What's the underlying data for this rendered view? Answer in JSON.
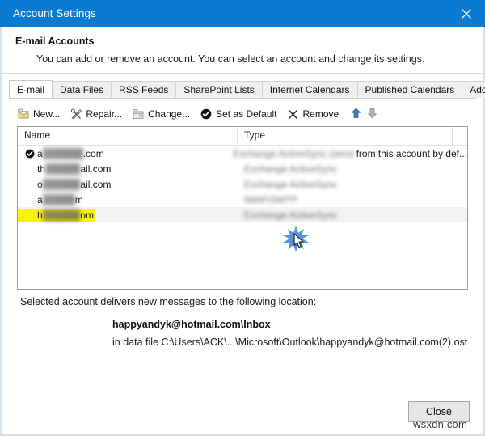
{
  "window": {
    "title": "Account Settings",
    "close_icon": "close-icon"
  },
  "header": {
    "title": "E-mail Accounts",
    "description": "You can add or remove an account. You can select an account and change its settings."
  },
  "tabs": [
    {
      "label": "E-mail",
      "active": true
    },
    {
      "label": "Data Files",
      "active": false
    },
    {
      "label": "RSS Feeds",
      "active": false
    },
    {
      "label": "SharePoint Lists",
      "active": false
    },
    {
      "label": "Internet Calendars",
      "active": false
    },
    {
      "label": "Published Calendars",
      "active": false
    },
    {
      "label": "Address Books",
      "active": false
    }
  ],
  "toolbar": {
    "new_label": "New...",
    "repair_label": "Repair...",
    "change_label": "Change...",
    "set_as_default_label": "Set as Default",
    "remove_label": "Remove",
    "move_up_icon": "arrow-up-icon",
    "move_down_icon": "arrow-down-icon"
  },
  "accounts_list": {
    "columns": [
      "Name",
      "Type"
    ],
    "rows": [
      {
        "is_default": true,
        "name_visible_start": "a",
        "name_redacted": "               ",
        "name_visible_end": ".com",
        "type_redacted": "Exchange ActiveSync (send",
        "type_visible_end": "from this account by def...",
        "highlighted": false
      },
      {
        "is_default": false,
        "name_visible_start": "th",
        "name_redacted": "             ",
        "name_visible_end": "ail.com",
        "type_redacted": "Exchange ActiveSync",
        "type_visible_end": "",
        "highlighted": false
      },
      {
        "is_default": false,
        "name_visible_start": "o",
        "name_redacted": "              ",
        "name_visible_end": "ail.com",
        "type_redacted": "Exchange ActiveSync",
        "type_visible_end": "",
        "highlighted": false
      },
      {
        "is_default": false,
        "name_visible_start": "a",
        "name_redacted": "            ",
        "name_visible_end": "m",
        "type_redacted": "IMAP/SMTP",
        "type_visible_end": "",
        "highlighted": false
      },
      {
        "is_default": false,
        "name_visible_start": "h",
        "name_redacted": "              ",
        "name_visible_end": "om",
        "type_redacted": "Exchange ActiveSync",
        "type_visible_end": "",
        "highlighted": true
      }
    ]
  },
  "delivery": {
    "caption": "Selected account delivers new messages to the following location:",
    "location": "happyandyk@hotmail.com\\Inbox",
    "data_file": "in data file C:\\Users\\ACK\\...\\Microsoft\\Outlook\\happyandyk@hotmail.com(2).ost"
  },
  "footer": {
    "close_label": "Close",
    "watermark": "wsxdn.com"
  },
  "colors": {
    "titlebar": "#0a7bd1",
    "highlight_yellow": "#fbf10a",
    "selected_row": "#f2f2f2",
    "window_border": "#cfe2f0"
  }
}
